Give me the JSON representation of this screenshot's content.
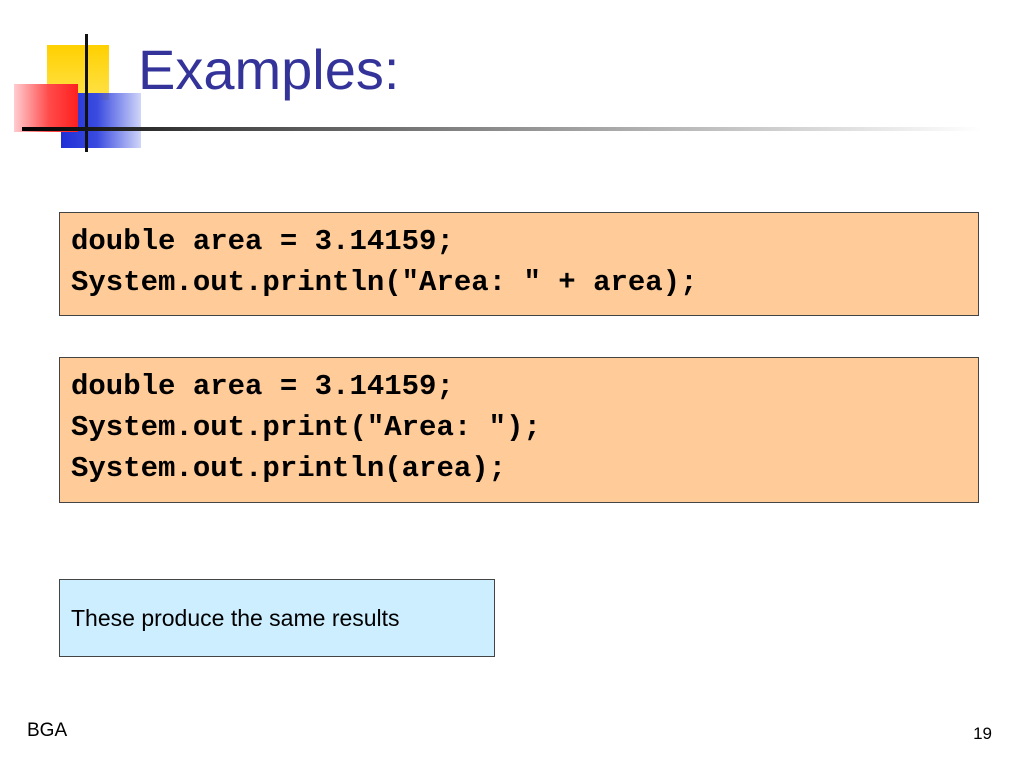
{
  "slide": {
    "title": "Examples:",
    "code_block_1": {
      "lines": [
        "double area = 3.14159;",
        "System.out.println(\"Area: \" + area);"
      ]
    },
    "code_block_2": {
      "lines": [
        "double area = 3.14159;",
        "System.out.print(\"Area: \");",
        "System.out.println(area);"
      ]
    },
    "note": "These produce the same results",
    "footer_label": "BGA",
    "page_number": "19"
  },
  "colors": {
    "title": "#333399",
    "code_box_bg": "#ffcc99",
    "note_box_bg": "#cceeff",
    "deco_yellow": "#ffd000",
    "deco_blue": "#1f2fd6",
    "deco_red": "#ff3030"
  }
}
